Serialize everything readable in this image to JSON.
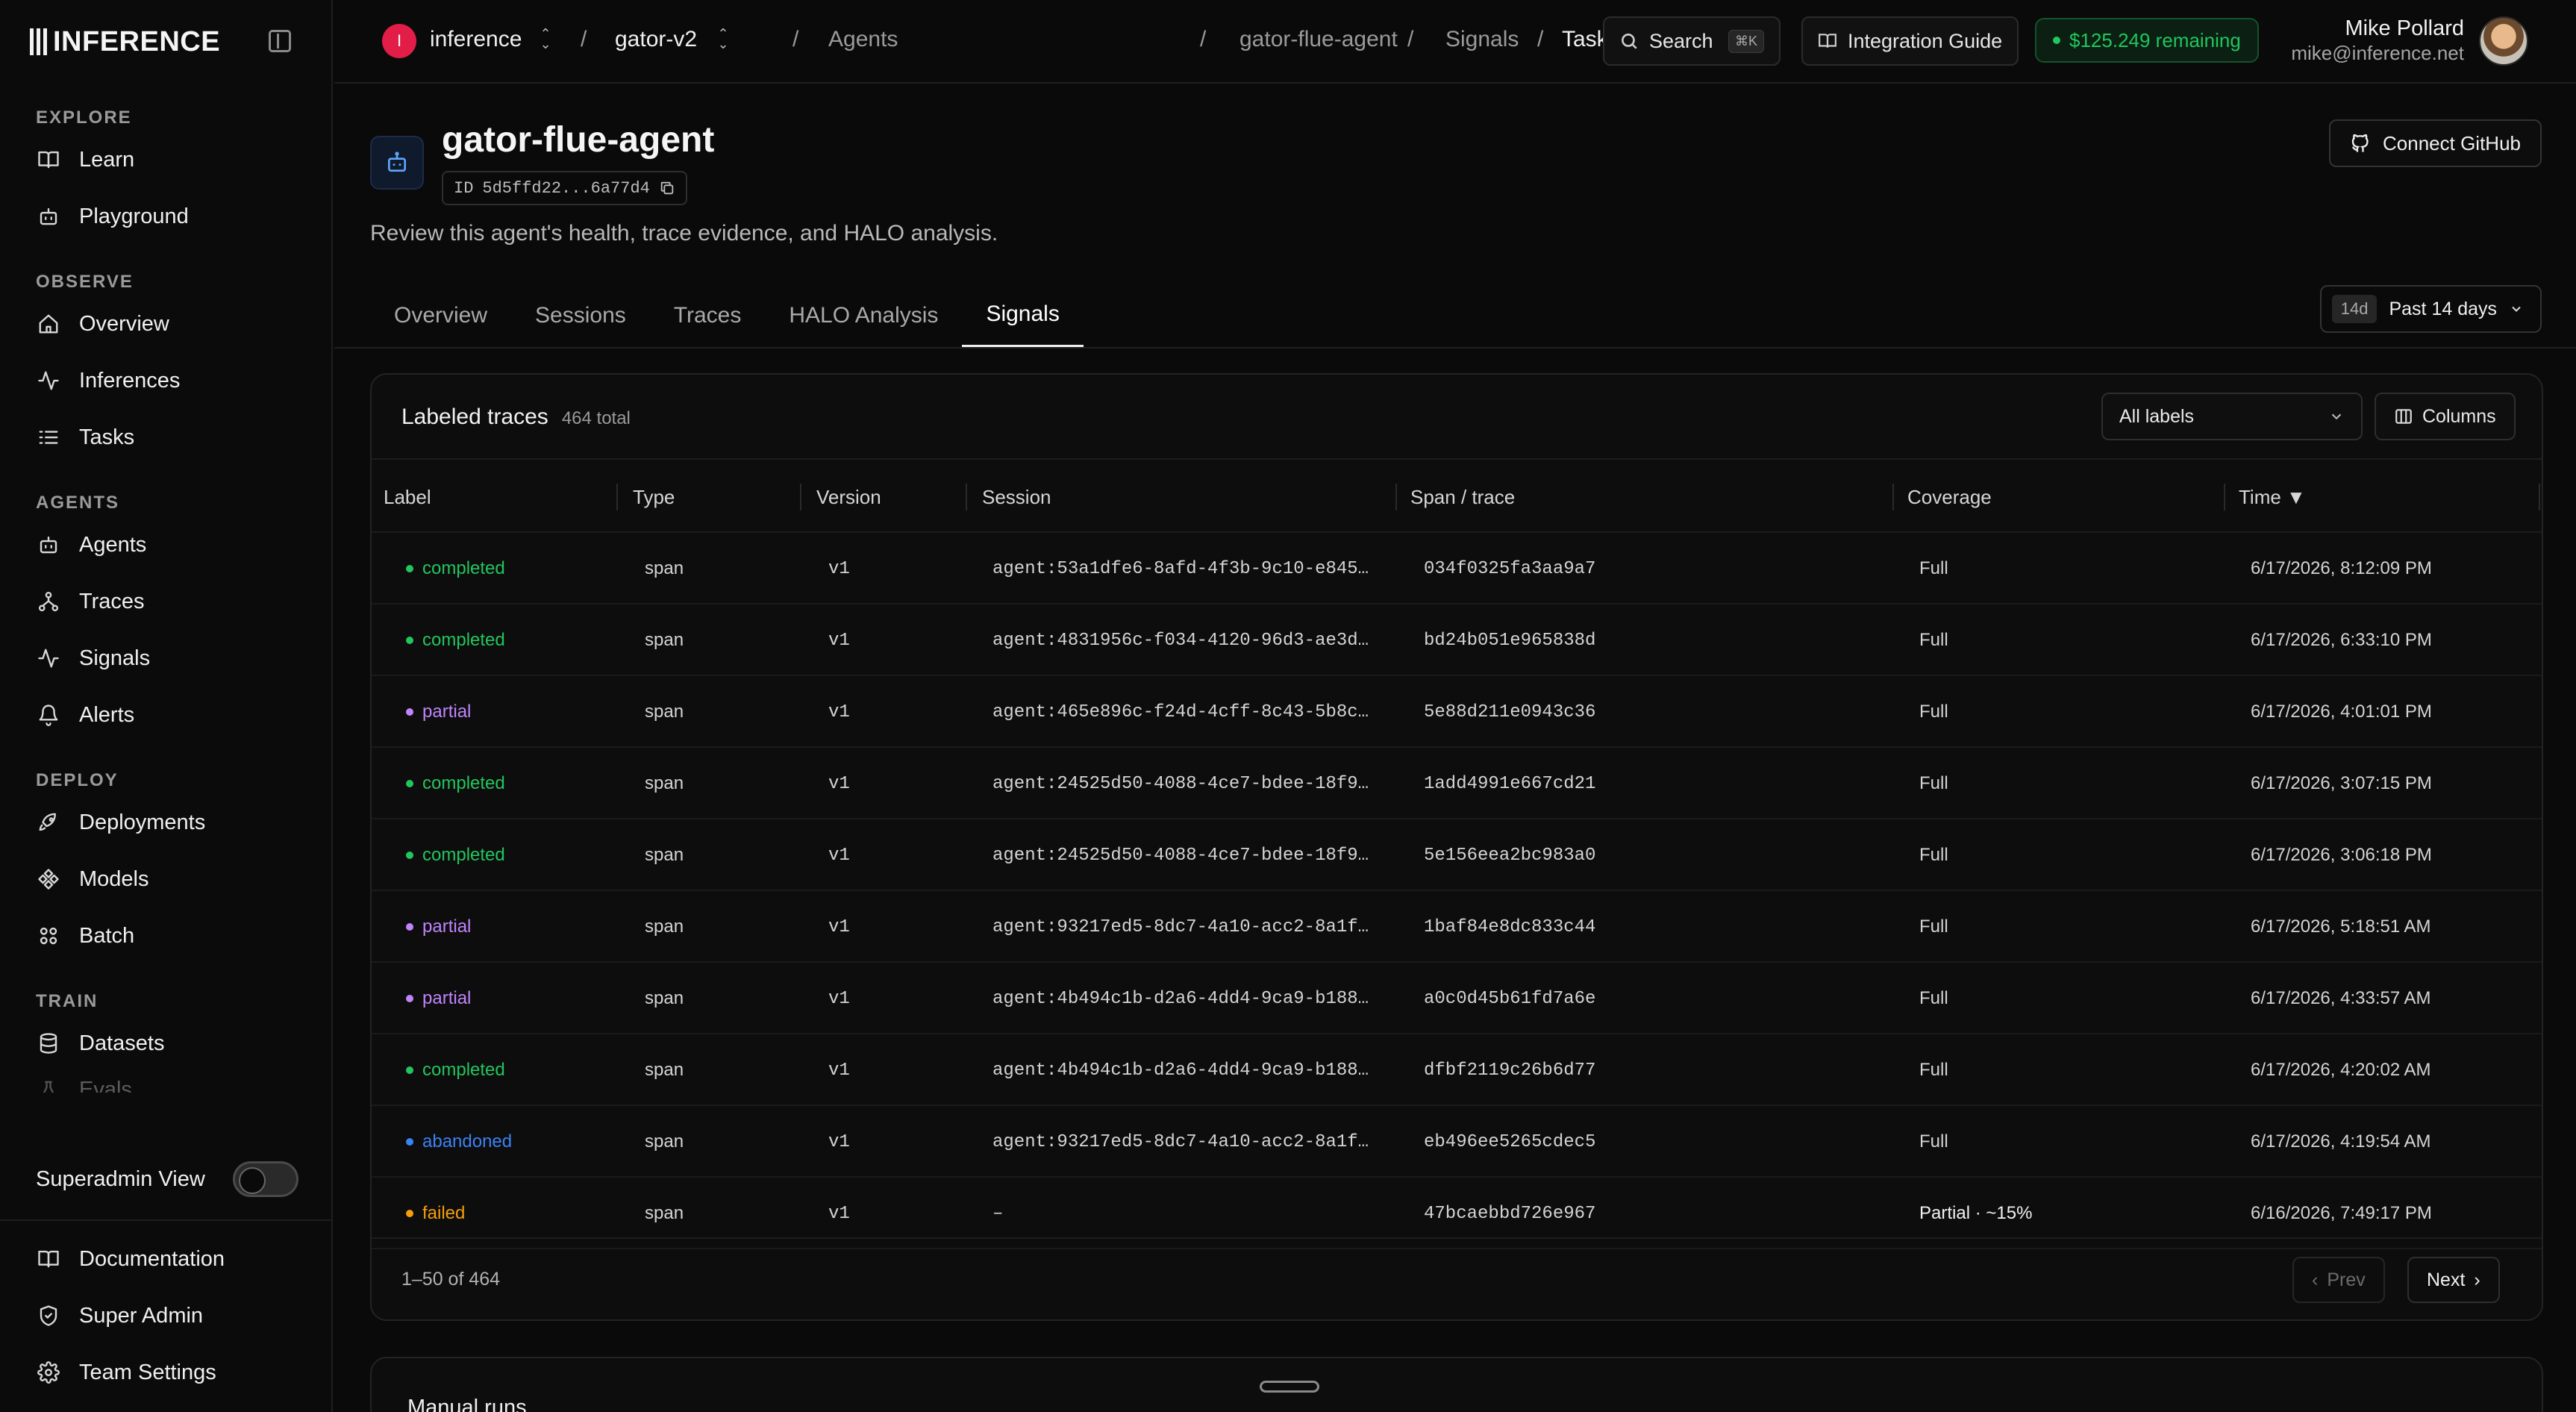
{
  "brand": {
    "name": "INFERENCE"
  },
  "sidebar": {
    "sections": [
      {
        "title": "EXPLORE",
        "items": [
          {
            "label": "Learn",
            "icon": "book-icon"
          },
          {
            "label": "Playground",
            "icon": "bot-icon"
          }
        ]
      },
      {
        "title": "OBSERVE",
        "items": [
          {
            "label": "Overview",
            "icon": "home-icon"
          },
          {
            "label": "Inferences",
            "icon": "activity-icon"
          },
          {
            "label": "Tasks",
            "icon": "list-icon"
          }
        ]
      },
      {
        "title": "AGENTS",
        "items": [
          {
            "label": "Agents",
            "icon": "bot-icon"
          },
          {
            "label": "Traces",
            "icon": "network-icon"
          },
          {
            "label": "Signals",
            "icon": "activity-icon"
          },
          {
            "label": "Alerts",
            "icon": "bell-icon"
          }
        ]
      },
      {
        "title": "DEPLOY",
        "items": [
          {
            "label": "Deployments",
            "icon": "rocket-icon"
          },
          {
            "label": "Models",
            "icon": "models-icon"
          },
          {
            "label": "Batch",
            "icon": "batch-icon"
          }
        ]
      },
      {
        "title": "TRAIN",
        "items": [
          {
            "label": "Datasets",
            "icon": "database-icon"
          },
          {
            "label": "Evals",
            "icon": "flask-icon"
          }
        ]
      }
    ],
    "superadmin_label": "Superadmin View",
    "bottom_items": [
      {
        "label": "Documentation",
        "icon": "book-icon"
      },
      {
        "label": "Super Admin",
        "icon": "shield-icon"
      },
      {
        "label": "Team Settings",
        "icon": "gear-icon"
      }
    ]
  },
  "topbar": {
    "org_initial": "I",
    "org": "inference",
    "project": "gator-v2",
    "breadcrumbs": [
      "Agents",
      "gator-flue-agent",
      "Signals",
      "Task outcome"
    ],
    "search_label": "Search",
    "search_shortcut": "⌘K",
    "guide_label": "Integration Guide",
    "credit": "$125.249 remaining",
    "user_name": "Mike Pollard",
    "user_email": "mike@inference.net"
  },
  "header": {
    "title": "gator-flue-agent",
    "id_label": "ID",
    "id_value": "5d5ffd22...6a77d4",
    "subtitle": "Review this agent's health, trace evidence, and HALO analysis.",
    "github_label": "Connect GitHub"
  },
  "tabs": [
    "Overview",
    "Sessions",
    "Traces",
    "HALO Analysis",
    "Signals"
  ],
  "active_tab": 4,
  "range": {
    "badge": "14d",
    "label": "Past 14 days"
  },
  "table": {
    "title": "Labeled traces",
    "count": "464 total",
    "filter_label": "All labels",
    "columns_label": "Columns",
    "headers": [
      "Label",
      "Type",
      "Version",
      "Session",
      "Span / trace",
      "Coverage",
      "Time ▼"
    ],
    "label_colors": {
      "completed": "#22c55e",
      "partial": "#c084fc",
      "abandoned": "#3b82f6",
      "failed": "#f59e0b"
    },
    "rows": [
      {
        "label": "completed",
        "type": "span",
        "version": "v1",
        "session": "agent:53a1dfe6-8afd-4f3b-9c10-e845…",
        "span": "034f0325fa3aa9a7",
        "coverage": "Full",
        "time": "6/17/2026, 8:12:09 PM"
      },
      {
        "label": "completed",
        "type": "span",
        "version": "v1",
        "session": "agent:4831956c-f034-4120-96d3-ae3d…",
        "span": "bd24b051e965838d",
        "coverage": "Full",
        "time": "6/17/2026, 6:33:10 PM"
      },
      {
        "label": "partial",
        "type": "span",
        "version": "v1",
        "session": "agent:465e896c-f24d-4cff-8c43-5b8c…",
        "span": "5e88d211e0943c36",
        "coverage": "Full",
        "time": "6/17/2026, 4:01:01 PM"
      },
      {
        "label": "completed",
        "type": "span",
        "version": "v1",
        "session": "agent:24525d50-4088-4ce7-bdee-18f9…",
        "span": "1add4991e667cd21",
        "coverage": "Full",
        "time": "6/17/2026, 3:07:15 PM"
      },
      {
        "label": "completed",
        "type": "span",
        "version": "v1",
        "session": "agent:24525d50-4088-4ce7-bdee-18f9…",
        "span": "5e156eea2bc983a0",
        "coverage": "Full",
        "time": "6/17/2026, 3:06:18 PM"
      },
      {
        "label": "partial",
        "type": "span",
        "version": "v1",
        "session": "agent:93217ed5-8dc7-4a10-acc2-8a1f…",
        "span": "1baf84e8dc833c44",
        "coverage": "Full",
        "time": "6/17/2026, 5:18:51 AM"
      },
      {
        "label": "partial",
        "type": "span",
        "version": "v1",
        "session": "agent:4b494c1b-d2a6-4dd4-9ca9-b188…",
        "span": "a0c0d45b61fd7a6e",
        "coverage": "Full",
        "time": "6/17/2026, 4:33:57 AM"
      },
      {
        "label": "completed",
        "type": "span",
        "version": "v1",
        "session": "agent:4b494c1b-d2a6-4dd4-9ca9-b188…",
        "span": "dfbf2119c26b6d77",
        "coverage": "Full",
        "time": "6/17/2026, 4:20:02 AM"
      },
      {
        "label": "abandoned",
        "type": "span",
        "version": "v1",
        "session": "agent:93217ed5-8dc7-4a10-acc2-8a1f…",
        "span": "eb496ee5265cdec5",
        "coverage": "Full",
        "time": "6/17/2026, 4:19:54 AM"
      },
      {
        "label": "failed",
        "type": "span",
        "version": "v1",
        "session": "–",
        "span": "47bcaebbd726e967",
        "coverage": "Partial · ~15%",
        "time": "6/16/2026, 7:49:17 PM"
      }
    ],
    "range_label": "1–50 of 464",
    "prev_label": "Prev",
    "next_label": "Next"
  },
  "manual_runs_title": "Manual runs"
}
